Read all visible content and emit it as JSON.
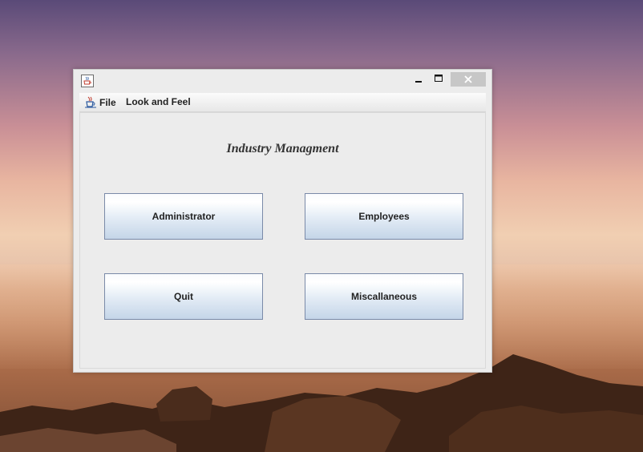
{
  "window": {
    "title": "",
    "icon": "java-cup-icon",
    "controls": [
      "minimize-icon",
      "maximize-icon",
      "close-icon"
    ]
  },
  "menubar": {
    "items": [
      {
        "label": "File",
        "icon": "java-cup-icon"
      },
      {
        "label": "Look and Feel"
      }
    ]
  },
  "main": {
    "title": "Industry Managment",
    "buttons": {
      "administrator": "Administrator",
      "employees": "Employees",
      "quit": "Quit",
      "miscellaneous": "Miscallaneous"
    }
  },
  "colors": {
    "button_gradient_top": "#ffffff",
    "button_gradient_bottom": "#c4d5e8",
    "button_border": "#7a8aa8",
    "window_bg": "#ececec",
    "close_button_bg": "#c7c7c7"
  }
}
